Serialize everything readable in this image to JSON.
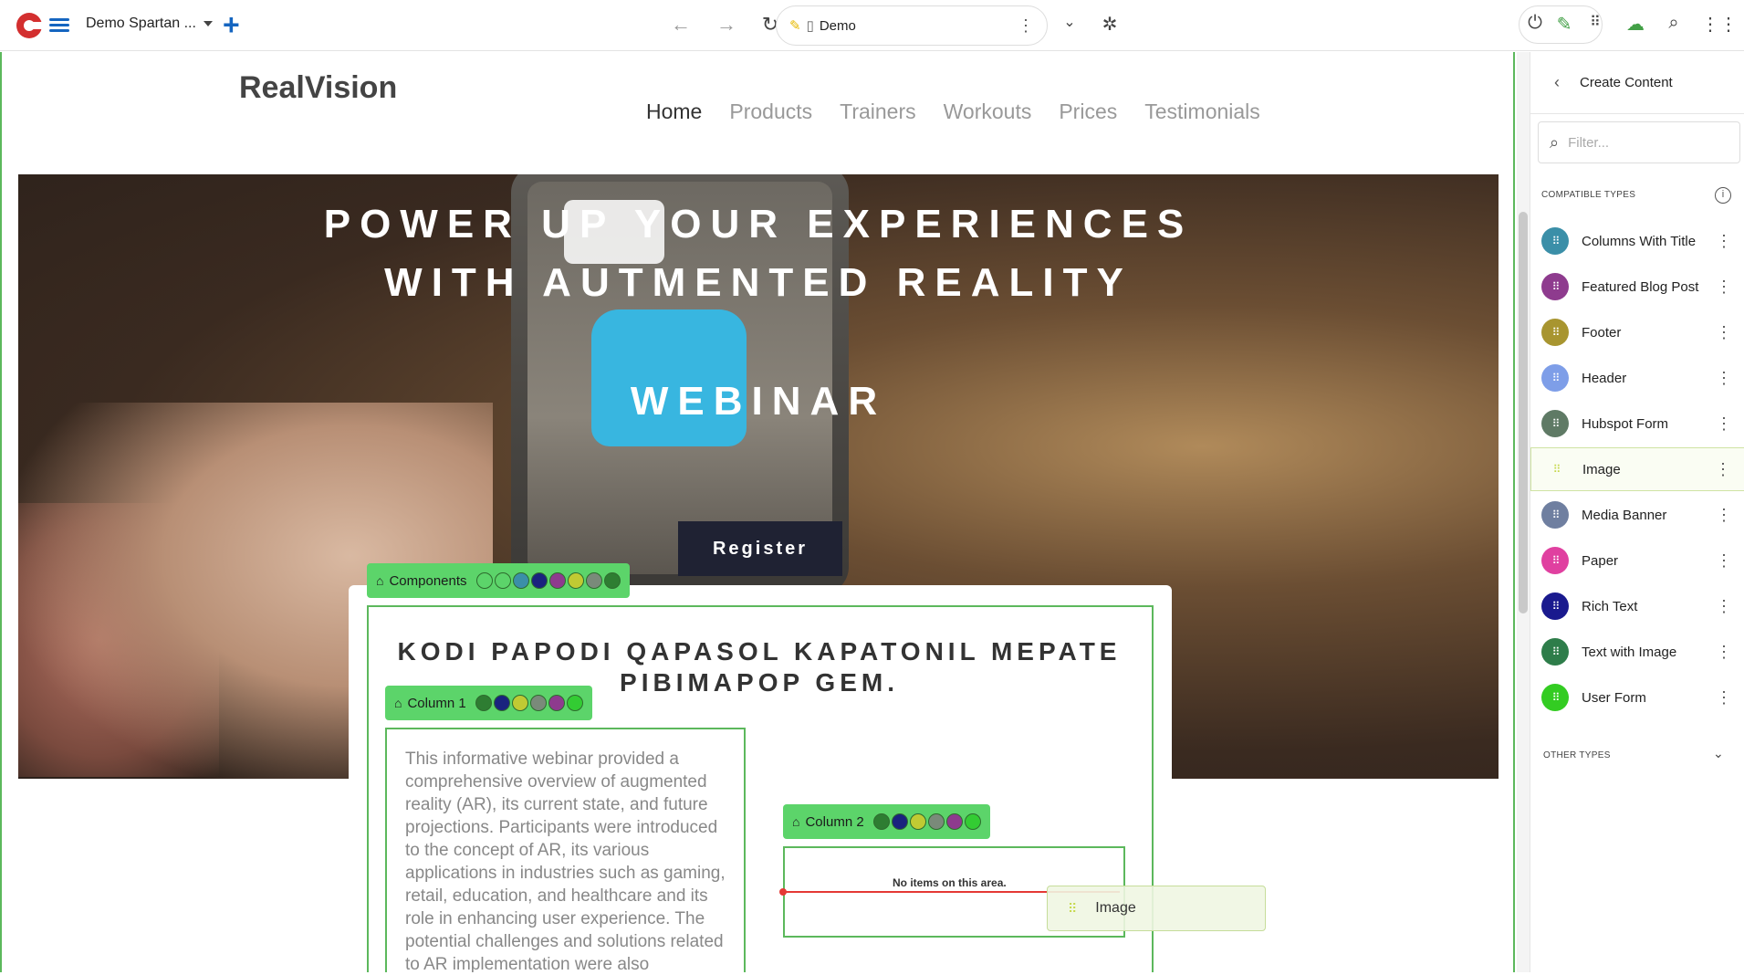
{
  "toolbar": {
    "site_name": "Demo Spartan ...",
    "address_text": "Demo"
  },
  "site": {
    "brand": "RealVision",
    "nav": [
      "Home",
      "Products",
      "Trainers",
      "Workouts",
      "Prices",
      "Testimonials"
    ],
    "hero_title_1": "POWER UP YOUR EXPERIENCES",
    "hero_title_2": "WITH AUTMENTED REALITY",
    "hero_title_3": "WEBINAR",
    "register_label": "Register",
    "components_label": "Components",
    "card_title": "KODI PAPODI QAPASOL KAPATONIL MEPATE PIBIMAPOP GEM.",
    "column1_label": "Column 1",
    "column1_text": "This informative webinar provided a comprehensive overview of augmented reality (AR), its current state, and future projections. Participants were introduced to the concept of AR, its various applications in industries such as gaming, retail, education, and healthcare and its role in enhancing user experience. The potential challenges and solutions related to AR implementation were also",
    "column2_label": "Column 2",
    "no_items": "No items on this area.",
    "drag_ghost_label": "Image"
  },
  "badge_colors": {
    "components": [
      "#5cd46a",
      "#5cd46a",
      "#3b8fa8",
      "#1a237e",
      "#8e3b8e",
      "#c0ca33",
      "#7a8a7a",
      "#2e7d32"
    ],
    "column1": [
      "#2e7d32",
      "#1a237e",
      "#c0ca33",
      "#7a8a7a",
      "#8e3b8e",
      "#33cc33"
    ],
    "column2": [
      "#2e7d32",
      "#1a237e",
      "#c0ca33",
      "#7a8a7a",
      "#8e3b8e",
      "#33cc33"
    ]
  },
  "panel": {
    "header": "Create Content",
    "filter_placeholder": "Filter...",
    "compatible_label": "COMPATIBLE TYPES",
    "other_label": "OTHER TYPES",
    "types": [
      {
        "label": "Columns With Title",
        "color": "#3b8fa8"
      },
      {
        "label": "Featured Blog Post",
        "color": "#8e3b8e"
      },
      {
        "label": "Footer",
        "color": "#a89530"
      },
      {
        "label": "Header",
        "color": "#7e9ee8"
      },
      {
        "label": "Hubspot Form",
        "color": "#5f7a65"
      },
      {
        "label": "Image",
        "color": "#c6d84c"
      },
      {
        "label": "Media Banner",
        "color": "#6f7fa0"
      },
      {
        "label": "Paper",
        "color": "#e040a0"
      },
      {
        "label": "Rich Text",
        "color": "#1a1a8e"
      },
      {
        "label": "Text with Image",
        "color": "#2e7d4a"
      },
      {
        "label": "User Form",
        "color": "#33cc22"
      }
    ]
  }
}
